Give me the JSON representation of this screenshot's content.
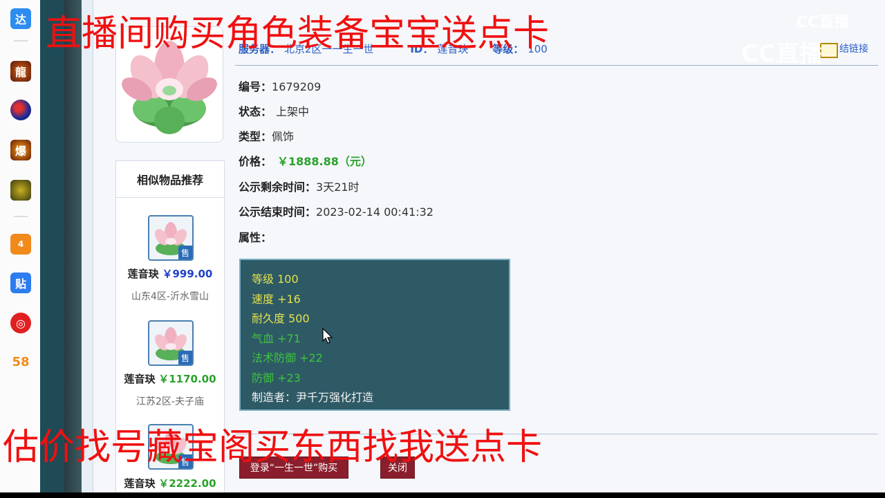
{
  "overlay": {
    "top_text": "直播间购买角色装备宝宝送点卡",
    "bottom_text": "估价找号藏宝阁买东西找我送点卡"
  },
  "watermark": {
    "small": "CC直播",
    "large": "CC直播"
  },
  "dock": {
    "items": [
      {
        "name": "dada-app-icon",
        "label": "达",
        "color": "#2d8cf0"
      },
      {
        "name": "dragon-game-icon",
        "label": "龍",
        "color": "#7a2a12"
      },
      {
        "name": "orb-game-icon",
        "label": "",
        "color": "#1a2a8a"
      },
      {
        "name": "explode-game-icon",
        "label": "爆",
        "color": "#c44a00"
      },
      {
        "name": "boost-game-icon",
        "label": "",
        "color": "#6a5a10"
      },
      {
        "name": "app-4399-icon",
        "label": "",
        "color": "#f08a1a"
      },
      {
        "name": "tieba-icon",
        "label": "贴",
        "color": "#2d7cf0"
      },
      {
        "name": "netease-music-icon",
        "label": "",
        "color": "#e02020"
      },
      {
        "name": "app-58-icon",
        "label": "58",
        "color": "#ffffff"
      }
    ]
  },
  "header": {
    "server_label": "服务器：",
    "server_value": "北京2区一一生一世",
    "id_label": "ID：",
    "id_value": "莲音玦",
    "level_label": "等级：",
    "level_value": "100",
    "right_link": "结链接"
  },
  "details": {
    "number_label": "编号：",
    "number_value": "1679209",
    "status_label": "状态：",
    "status_value": "上架中",
    "type_label": "类型：",
    "type_value": "佩饰",
    "price_label": "价格：",
    "price_value": "￥1888.88（元）",
    "remain_label": "公示剩余时间：",
    "remain_value": "3天21时",
    "end_label": "公示结束时间：",
    "end_value": "2023-02-14 00:41:32",
    "attr_label": "属性："
  },
  "attributes": [
    {
      "text": "等级  100",
      "color": "yellow"
    },
    {
      "text": "速度  +16",
      "color": "yellow"
    },
    {
      "text": "耐久度  500",
      "color": "yellow"
    },
    {
      "text": "气血  +71",
      "color": "green"
    },
    {
      "text": "法术防御  +22",
      "color": "green"
    },
    {
      "text": "防御  +23",
      "color": "green"
    },
    {
      "text": "制造者：尹千万强化打造",
      "color": "white"
    }
  ],
  "buttons": {
    "buy": "登录“一生一世”购买",
    "close": "关闭"
  },
  "similar": {
    "title": "相似物品推荐",
    "badge": "售",
    "items": [
      {
        "name": "莲音玦",
        "price": "￥999.00",
        "server": "山东4区-沂水雪山"
      },
      {
        "name": "莲音玦",
        "price": "￥1170.00",
        "server": "江苏2区-夫子庙"
      },
      {
        "name": "莲音玦",
        "price": "￥2222.00",
        "server": ""
      }
    ]
  }
}
